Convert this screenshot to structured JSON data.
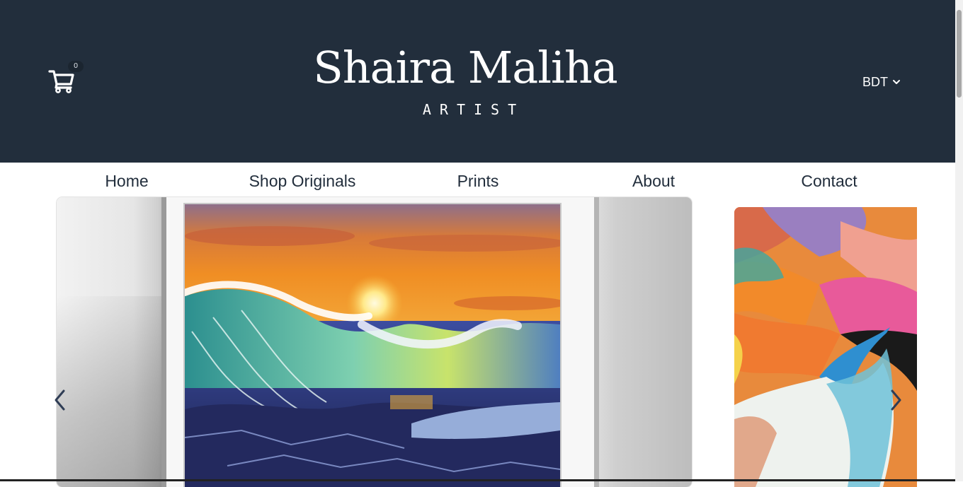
{
  "header": {
    "brand_name": "Shaira Maliha",
    "tagline": "ARTIST",
    "cart_count": "0",
    "cart_icon": "shopping-cart-icon",
    "currency": "BDT",
    "background_color": "#222e3c"
  },
  "nav": {
    "items": [
      {
        "label": "Home"
      },
      {
        "label": "Shop Originals"
      },
      {
        "label": "Prints"
      },
      {
        "label": "About"
      },
      {
        "label": "Contact"
      }
    ]
  },
  "carousel": {
    "prev_icon": "chevron-left-icon",
    "next_icon": "chevron-right-icon"
  }
}
